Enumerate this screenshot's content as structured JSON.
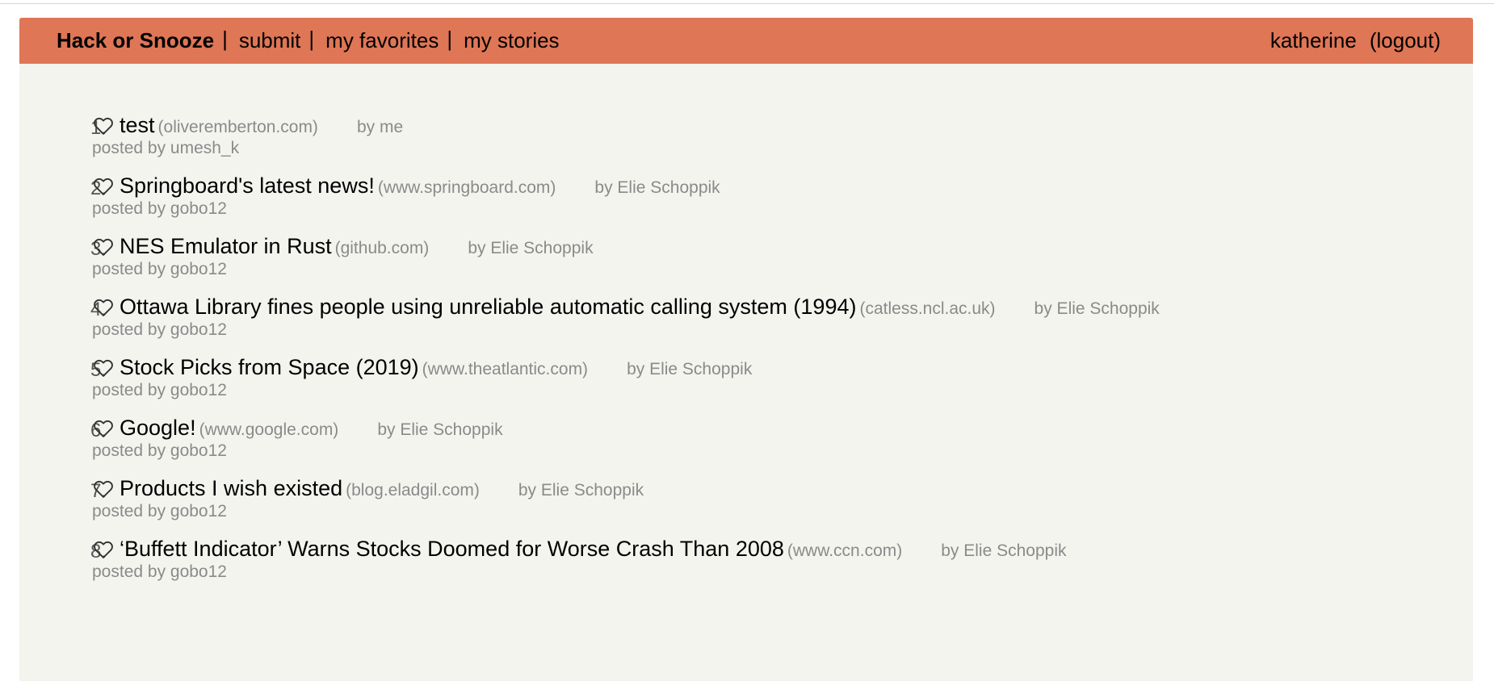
{
  "nav": {
    "brand": "Hack or Snooze",
    "links": [
      "submit",
      "my favorites",
      "my stories"
    ],
    "separator": "|",
    "user": "katherine",
    "logout": "(logout)"
  },
  "colors": {
    "navbar": "#df7656",
    "background": "#f4f4ef",
    "meta_text": "#8a8a8a"
  },
  "stories": [
    {
      "num": "1.",
      "title": "test",
      "host": "(oliveremberton.com)",
      "author": "by me",
      "posted_by": "posted by umesh_k"
    },
    {
      "num": "2.",
      "title": "Springboard's latest news!",
      "host": "(www.springboard.com)",
      "author": "by Elie Schoppik",
      "posted_by": "posted by gobo12"
    },
    {
      "num": "3.",
      "title": "NES Emulator in Rust",
      "host": "(github.com)",
      "author": "by Elie Schoppik",
      "posted_by": "posted by gobo12"
    },
    {
      "num": "4.",
      "title": "Ottawa Library fines people using unreliable automatic calling system (1994)",
      "host": "(catless.ncl.ac.uk)",
      "author": "by Elie Schoppik",
      "posted_by": "posted by gobo12"
    },
    {
      "num": "5.",
      "title": "Stock Picks from Space (2019)",
      "host": "(www.theatlantic.com)",
      "author": "by Elie Schoppik",
      "posted_by": "posted by gobo12"
    },
    {
      "num": "6.",
      "title": "Google!",
      "host": "(www.google.com)",
      "author": "by Elie Schoppik",
      "posted_by": "posted by gobo12"
    },
    {
      "num": "7.",
      "title": "Products I wish existed",
      "host": "(blog.eladgil.com)",
      "author": "by Elie Schoppik",
      "posted_by": "posted by gobo12"
    },
    {
      "num": "8.",
      "title": "‘Buffett Indicator’ Warns Stocks Doomed for Worse Crash Than 2008",
      "host": "(www.ccn.com)",
      "author": "by Elie Schoppik",
      "posted_by": "posted by gobo12"
    }
  ]
}
